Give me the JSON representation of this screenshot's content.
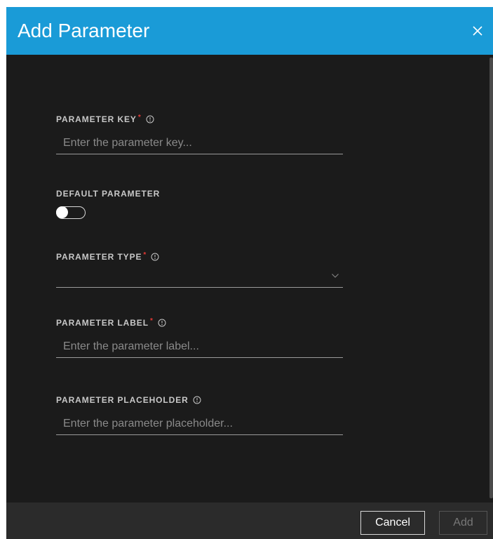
{
  "dialog": {
    "title": "Add Parameter",
    "close_icon": "close-icon"
  },
  "fields": {
    "parameter_key": {
      "label": "PARAMETER KEY",
      "required_marker": "*",
      "placeholder": "Enter the parameter key...",
      "value": ""
    },
    "default_parameter": {
      "label": "DEFAULT PARAMETER",
      "toggle_state": "off"
    },
    "parameter_type": {
      "label": "PARAMETER TYPE",
      "required_marker": "*",
      "selected_value": ""
    },
    "parameter_label": {
      "label": "PARAMETER LABEL",
      "required_marker": "*",
      "placeholder": "Enter the parameter label...",
      "value": ""
    },
    "parameter_placeholder": {
      "label": "PARAMETER PLACEHOLDER",
      "placeholder": "Enter the parameter placeholder...",
      "value": ""
    }
  },
  "footer": {
    "cancel_label": "Cancel",
    "add_label": "Add"
  },
  "colors": {
    "header_bg": "#1a9bd7",
    "body_bg": "#1b1b1b",
    "footer_bg": "#2b2b2b",
    "required_red": "#e53935",
    "label_text": "#c8c8c8"
  }
}
